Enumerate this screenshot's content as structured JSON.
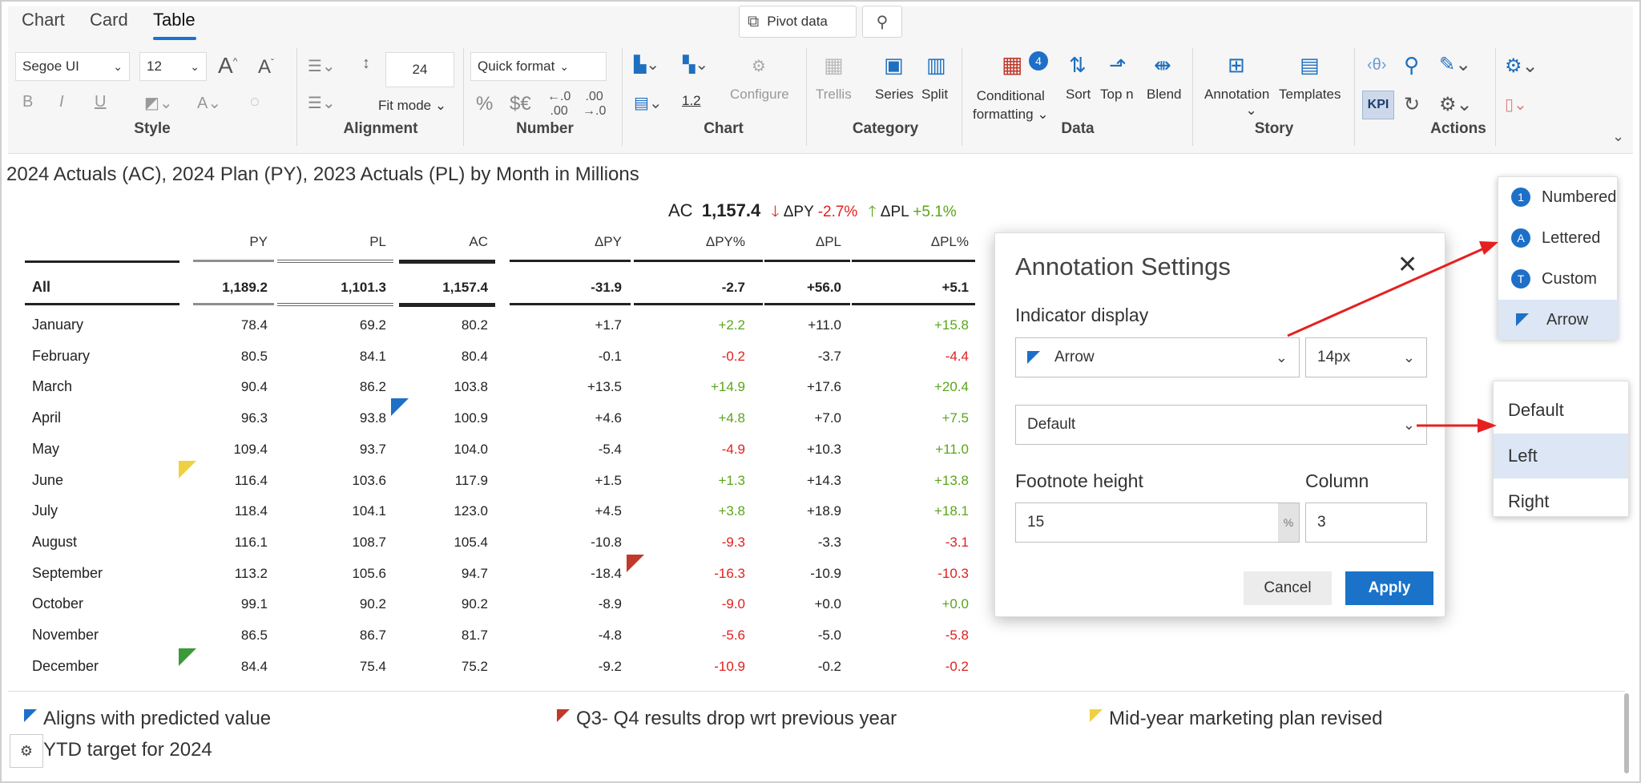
{
  "tabs": [
    "Chart",
    "Card",
    "Table"
  ],
  "topbar": {
    "pivot_label": "Pivot data"
  },
  "ribbon": {
    "style": {
      "font": "Segoe UI",
      "size": "12",
      "label": "Style"
    },
    "alignment": {
      "spacing": "24",
      "fit_mode": "Fit mode",
      "label": "Alignment"
    },
    "number": {
      "quick_format": "Quick format",
      "pct": "%",
      "currency": "$€",
      "label": "Number"
    },
    "chart": {
      "value": "1.2",
      "configure": "Configure",
      "label": "Chart"
    },
    "category": {
      "trellis": "Trellis",
      "series": "Series",
      "split": "Split",
      "label": "Category"
    },
    "data": {
      "conditional": "Conditional",
      "formatting": "formatting",
      "badge": "4",
      "sort": "Sort",
      "topn": "Top n",
      "blend": "Blend",
      "label": "Data"
    },
    "story": {
      "annotation": "Annotation",
      "templates": "Templates",
      "label": "Story"
    },
    "actions": {
      "kpi": "KPI",
      "label": "Actions"
    }
  },
  "title": "2024 Actuals (AC), 2024 Plan (PY), 2023 Actuals (PL) by Month in Millions",
  "kpi": {
    "ac_label": "AC",
    "ac_value": "1,157.4",
    "dpy_label": "ΔPY",
    "dpy_value": "-2.7%",
    "dpl_label": "ΔPL",
    "dpl_value": "+5.1%"
  },
  "table": {
    "headers": [
      "PY",
      "PL",
      "AC",
      "ΔPY",
      "ΔPY%",
      "ΔPL",
      "ΔPL%"
    ],
    "total": {
      "label": "All",
      "values": [
        "1,189.2",
        "1,101.3",
        "1,157.4",
        "-31.9",
        "-2.7",
        "+56.0",
        "+5.1"
      ]
    },
    "rows": [
      {
        "label": "January",
        "values": [
          "78.4",
          "69.2",
          "80.2",
          "+1.7",
          "+2.2",
          "+11.0",
          "+15.8"
        ]
      },
      {
        "label": "February",
        "values": [
          "80.5",
          "84.1",
          "80.4",
          "-0.1",
          "-0.2",
          "-3.7",
          "-4.4"
        ]
      },
      {
        "label": "March",
        "values": [
          "90.4",
          "86.2",
          "103.8",
          "+13.5",
          "+14.9",
          "+17.6",
          "+20.4"
        ]
      },
      {
        "label": "April",
        "values": [
          "96.3",
          "93.8",
          "100.9",
          "+4.6",
          "+4.8",
          "+7.0",
          "+7.5"
        ]
      },
      {
        "label": "May",
        "values": [
          "109.4",
          "93.7",
          "104.0",
          "-5.4",
          "-4.9",
          "+10.3",
          "+11.0"
        ]
      },
      {
        "label": "June",
        "values": [
          "116.4",
          "103.6",
          "117.9",
          "+1.5",
          "+1.3",
          "+14.3",
          "+13.8"
        ]
      },
      {
        "label": "July",
        "values": [
          "118.4",
          "104.1",
          "123.0",
          "+4.5",
          "+3.8",
          "+18.9",
          "+18.1"
        ]
      },
      {
        "label": "August",
        "values": [
          "116.1",
          "108.7",
          "105.4",
          "-10.8",
          "-9.3",
          "-3.3",
          "-3.1"
        ]
      },
      {
        "label": "September",
        "values": [
          "113.2",
          "105.6",
          "94.7",
          "-18.4",
          "-16.3",
          "-10.9",
          "-10.3"
        ]
      },
      {
        "label": "October",
        "values": [
          "99.1",
          "90.2",
          "90.2",
          "-8.9",
          "-9.0",
          "+0.0",
          "+0.0"
        ]
      },
      {
        "label": "November",
        "values": [
          "86.5",
          "86.7",
          "81.7",
          "-4.8",
          "-5.6",
          "-5.0",
          "-5.8"
        ]
      },
      {
        "label": "December",
        "values": [
          "84.4",
          "75.4",
          "75.2",
          "-9.2",
          "-10.9",
          "-0.2",
          "-0.2"
        ]
      }
    ]
  },
  "footnotes": [
    {
      "text": "Aligns with predicted value",
      "color": "#1e6fc8"
    },
    {
      "text": "Q3- Q4 results drop wrt previous year",
      "color": "#c0392b"
    },
    {
      "text": "Mid-year marketing plan revised",
      "color": "#f0d040"
    },
    {
      "text": "YTD target for 2024",
      "color": "#3a9a3a"
    }
  ],
  "dialog": {
    "title": "Annotation Settings",
    "indicator_label": "Indicator display",
    "indicator_value": "Arrow",
    "size_value": "14px",
    "position_value": "Default",
    "footnote_label": "Footnote height",
    "footnote_value": "15",
    "footnote_unit": "%",
    "column_label": "Column",
    "column_value": "3",
    "cancel": "Cancel",
    "apply": "Apply"
  },
  "indicator_menu": [
    {
      "label": "Numbered",
      "glyph": "1"
    },
    {
      "label": "Lettered",
      "glyph": "A"
    },
    {
      "label": "Custom",
      "glyph": "T"
    },
    {
      "label": "Arrow",
      "glyph": ""
    }
  ],
  "position_menu": [
    "Default",
    "Left",
    "Right"
  ],
  "colors": {
    "accent": "#1a73c9",
    "negative": "#e02020",
    "positive": "#5aa51a"
  }
}
